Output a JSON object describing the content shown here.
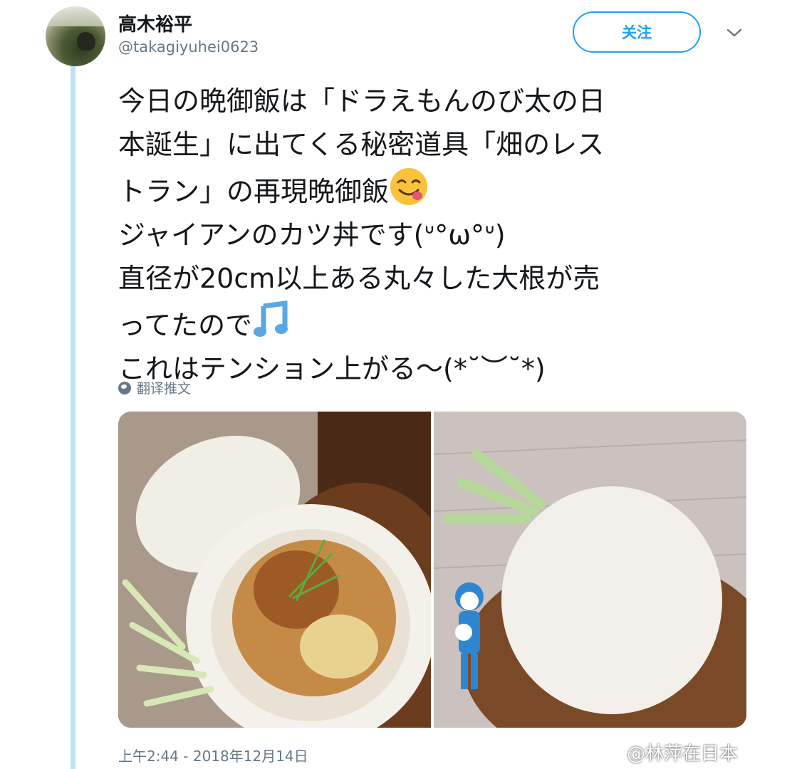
{
  "user": {
    "display_name": "高木裕平",
    "handle": "@takagiyuhei0623"
  },
  "header": {
    "follow_label": "关注"
  },
  "tweet": {
    "lines": [
      "今日の晩御飯は「ドラえもんのび太の日",
      "本誕生」に出てくる秘密道具「畑のレス",
      "トラン」の再現晩御飯",
      "ジャイアンのカツ丼です(ᐡ°ω°ᐡ)",
      "直径が20cm以上ある丸々した大根が売",
      "ってたので",
      "これはテンション上がる〜(*˘︶˘*)"
    ],
    "emoji_1": "face-savoring-food-emoji",
    "emoji_2": "musical-notes-emoji"
  },
  "translate_label": "翻译推文",
  "media": [
    {
      "description_icon": "daikon-katsudon-photo"
    },
    {
      "description_icon": "whole-daikon-doraemon-photo"
    }
  ],
  "timestamp": "上午2:44 - 2018年12月14日",
  "watermark": "@林萍在日本",
  "colors": {
    "accent": "#1da1f2",
    "thread_line": "#bfe0f6",
    "secondary_text": "#657786"
  }
}
